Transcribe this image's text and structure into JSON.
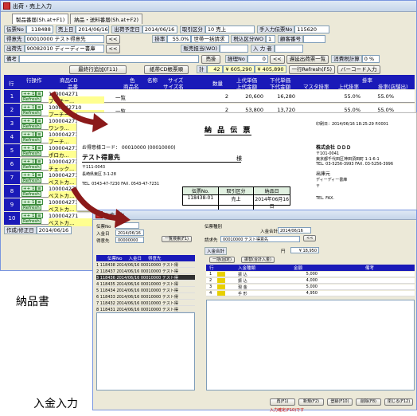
{
  "sales_window": {
    "title": "出荷・売上入力",
    "tabs": [
      "製品番届(Sh.at+F1)",
      "納品・送料番届(Sh.at+F2)"
    ],
    "fields": {
      "slip_no_label": "伝票No",
      "slip_no": "118488",
      "sales_date_label": "売上日",
      "sales_date": "2014/06/16",
      "ship_date_label": "出荷予定日",
      "ship_date": "2014/06/16",
      "trade_label": "取引区分",
      "trade": "10 売上",
      "entry_label": "手入力伝票No",
      "entry": "115620",
      "client_label": "得意先",
      "client": "00010000 テスト得意先",
      "tax_label": "掛率",
      "tax": "55.0%",
      "tax_note": "世帯一括請求",
      "target_label": "税込区分WO",
      "target_value": "1",
      "customer_label": "顧客番号",
      "shipto_label": "出荷先",
      "shipto": "90082010 ディーディー書庫",
      "rep_label": "販売担当(WO)",
      "input_label": "入 力 者",
      "note_label": "備考",
      "bill_button": "売掛",
      "nav_no": "0",
      "nav_no_label": "経理No",
      "stock_button": "遅延出荷票一覧",
      "tax_calc_label": "消費税計算",
      "tax_calc_value": "0 %"
    },
    "toolbar": {
      "add_row": "最終行追加(F11)",
      "cd_sort": "紙帯CD帳票順",
      "total_label": "計",
      "total_qty": "42",
      "total_amount": "¥ 605,290",
      "total_cost": "¥ 405,890",
      "refresh": "一行Refresh(F5)",
      "barcode": "バーコード入力"
    },
    "grid_headers": [
      "行",
      "行操作",
      "商品CD",
      "品番",
      "商品名",
      "色",
      "名称",
      "サイズ",
      "サイズ名",
      "数量",
      "上代単価",
      "上代金額",
      "下代単価",
      "下代金額",
      "マスタ掛率",
      "掛率",
      "上代掛率",
      "掛率(店舗出)"
    ],
    "rows": [
      {
        "n": "1",
        "code": "100004271",
        "name": "プーチー...",
        "qty": "2",
        "price": "20,600",
        "cost": "16,280",
        "rate": "55.0%",
        "srate": "55.0%",
        "show_menu": "一覧"
      },
      {
        "n": "2",
        "code": "1000042710",
        "name": "プーチー...",
        "qty": "2",
        "price": "53,800",
        "cost": "13,720",
        "rate": "55.0%",
        "srate": "55.0%",
        "show_menu": "一覧"
      },
      {
        "n": "3",
        "code": "100004271",
        "name": "ワンラ...",
        "qty": "2",
        "price": "20,600",
        "cost": "16,280",
        "rate": "55.0%",
        "srate": "",
        "show_menu": "一覧"
      },
      {
        "n": "4",
        "code": "1000042710",
        "name": "プーチ...",
        "qty": "",
        "price": "",
        "cost": "",
        "rate": "",
        "srate": "",
        "show_menu": ""
      },
      {
        "n": "5",
        "code": "1000042711",
        "name": "ポロカ...",
        "qty": "",
        "price": "",
        "cost": "",
        "rate": "",
        "srate": "",
        "show_menu": ""
      },
      {
        "n": "6",
        "code": "100004271",
        "name": "チェック...",
        "qty": "",
        "price": "",
        "cost": "",
        "rate": "",
        "srate": "",
        "show_menu": ""
      },
      {
        "n": "7",
        "code": "100004271",
        "name": "ベストカ...",
        "qty": "",
        "price": "",
        "cost": "",
        "rate": "",
        "srate": "",
        "show_menu": ""
      },
      {
        "n": "8",
        "code": "100004271",
        "name": "ベストカ...",
        "qty": "",
        "price": "",
        "cost": "",
        "rate": "",
        "srate": "",
        "show_menu": ""
      },
      {
        "n": "9",
        "code": "100004271",
        "name": "ベストカ...",
        "qty": "",
        "price": "",
        "cost": "",
        "rate": "",
        "srate": "",
        "show_menu": ""
      },
      {
        "n": "10",
        "code": "100004271",
        "name": "ベストカ...",
        "qty": "",
        "price": "",
        "cost": "",
        "rate": "",
        "srate": "",
        "show_menu": ""
      }
    ],
    "row_btn_add": "++ 1",
    "row_btn_refresh": "Refresh",
    "footer_label": "作成/修正日",
    "footer_date": "2014/06/16"
  },
  "delivery_note": {
    "title": "納 品 伝 票",
    "print_date": "印刷日：2014/06/16 18:25:29 P.0001",
    "customer_code": "お得意様コード：  00010000  (00010000)",
    "customer_name": "テスト得意先",
    "honorific": "様",
    "postcode": "〒111-0043",
    "address": "長崎県東区 3-1-28",
    "tel": "TEL. 0543-47-7230    FAX. 0543-47-7231",
    "company": "株式会社 ＤＤＤ",
    "company_post": "〒101-0041",
    "company_address": "東京都千代田区神田須田町 1-1-6-1",
    "company_tel": "TEL. 03-5256-3993  FAX. 03-5256-3996",
    "shipto_label": "出庫元",
    "shipto": "ディーディー書庫",
    "shipto_post": "〒",
    "shipto_tel": "TEL.                    FAX.",
    "table_headers": [
      "伝票No.",
      "取引区分",
      "納品日"
    ],
    "table_values": [
      "118438-01",
      "売上",
      "2014年06月16日"
    ]
  },
  "deposit_window": {
    "title": "入金入力",
    "fields": {
      "slip_label": "伝票No",
      "date_label": "入金日",
      "date": "2014/06/16",
      "client_label": "得意先",
      "client": "00000000",
      "search_button": "一覧検索(F1)",
      "kind_label": "伝票種別",
      "amount_label": "入金合計",
      "amount": "2014/06/16",
      "bill_label": "請求先",
      "bill": "00010000 テスト得意先",
      "note_label": "入金合計",
      "note_value": "¥ 18,950",
      "tab_a": "一括(固定)",
      "tab_b": "振替(合計入金)"
    },
    "list_headers": [
      "伝票No",
      "入金日",
      "得意先"
    ],
    "list_rows": [
      "1  118438  2014/06/16  00010000  テスト得",
      "2  118437  2014/06/16  00010000  テスト得",
      "3  118436  2014/06/16  00010000  テスト得",
      "4  118435  2014/06/16  00010000  テスト得",
      "5  118434  2014/06/16  00010000  テスト得",
      "6  118433  2014/06/16  00010000  テスト得",
      "7  118432  2014/06/16  00010000  テスト得",
      "8  118431  2014/06/16  00010000  テスト得"
    ],
    "right_headers": [
      "行",
      "入金種類",
      "金額",
      "備考"
    ],
    "right_rows": [
      [
        "1",
        "振 込",
        "5,000",
        ""
      ],
      [
        "2",
        "振 込",
        "4,000",
        ""
      ],
      [
        "3",
        "現 金",
        "5,000",
        ""
      ],
      [
        "4",
        "手 形",
        "4,950",
        ""
      ]
    ],
    "buttons": [
      "再(F1)",
      "新規(F2)",
      "登録(F10)",
      "削除(F8)",
      "閉じる(F12)"
    ],
    "warning": "入力確定(F10)です"
  },
  "captions": {
    "delivery": "納品書",
    "deposit": "入金入力"
  },
  "colors": {
    "grid_header": "#1a1ab8",
    "arrow": "#8b1a1a"
  }
}
